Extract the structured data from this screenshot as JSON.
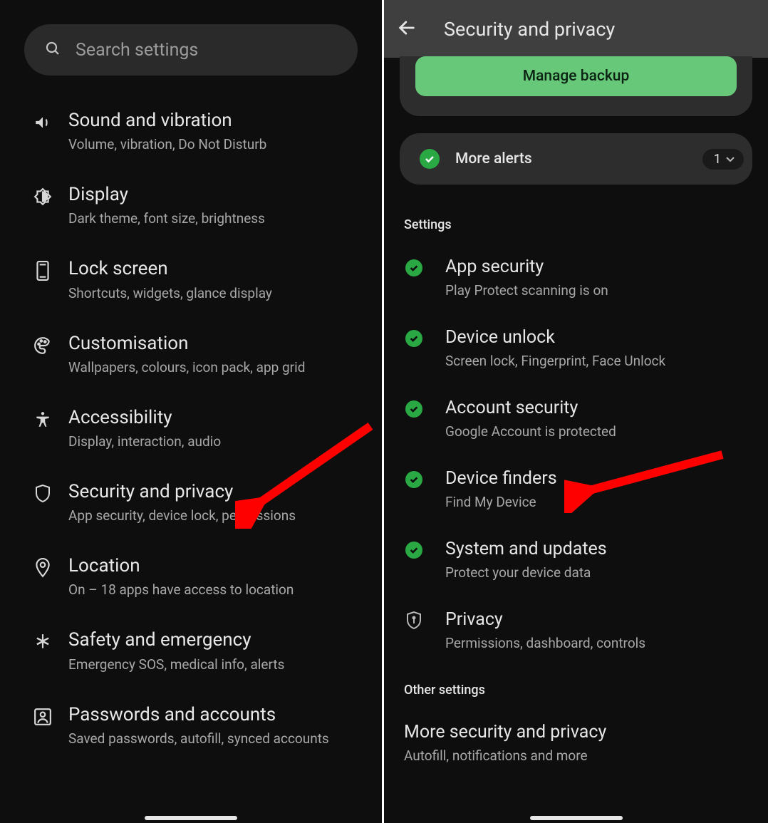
{
  "left": {
    "search_placeholder": "Search settings",
    "items": [
      {
        "title": "Sound and vibration",
        "sub": "Volume, vibration, Do Not Disturb",
        "icon": "sound-icon"
      },
      {
        "title": "Display",
        "sub": "Dark theme, font size, brightness",
        "icon": "brightness-icon"
      },
      {
        "title": "Lock screen",
        "sub": "Shortcuts, widgets, glance display",
        "icon": "phone-icon"
      },
      {
        "title": "Customisation",
        "sub": "Wallpapers, colours, icon pack, app grid",
        "icon": "palette-icon"
      },
      {
        "title": "Accessibility",
        "sub": "Display, interaction, audio",
        "icon": "accessibility-icon"
      },
      {
        "title": "Security and privacy",
        "sub": "App security, device lock, permissions",
        "icon": "shield-icon"
      },
      {
        "title": "Location",
        "sub": "On – 18 apps have access to location",
        "icon": "location-icon"
      },
      {
        "title": "Safety and emergency",
        "sub": "Emergency SOS, medical info, alerts",
        "icon": "asterisk-icon"
      },
      {
        "title": "Passwords and accounts",
        "sub": "Saved passwords, autofill, synced accounts",
        "icon": "account-icon"
      }
    ]
  },
  "right": {
    "header_title": "Security and privacy",
    "manage_backup_label": "Manage backup",
    "more_alerts_label": "More alerts",
    "more_alerts_count": "1",
    "section_label_settings": "Settings",
    "section_label_other": "Other settings",
    "settings_items": [
      {
        "title": "App security",
        "sub": "Play Protect scanning is on",
        "check": true
      },
      {
        "title": "Device unlock",
        "sub": "Screen lock, Fingerprint, Face Unlock",
        "check": true
      },
      {
        "title": "Account security",
        "sub": "Google Account is protected",
        "check": true
      },
      {
        "title": "Device finders",
        "sub": "Find My Device",
        "check": true
      },
      {
        "title": "System and updates",
        "sub": "Protect your device data",
        "check": true
      },
      {
        "title": "Privacy",
        "sub": "Permissions, dashboard, controls",
        "check": false,
        "icon": "privacy-shield-icon"
      }
    ],
    "other_items": [
      {
        "title": "More security and privacy",
        "sub": "Autofill, notifications and more"
      }
    ]
  }
}
